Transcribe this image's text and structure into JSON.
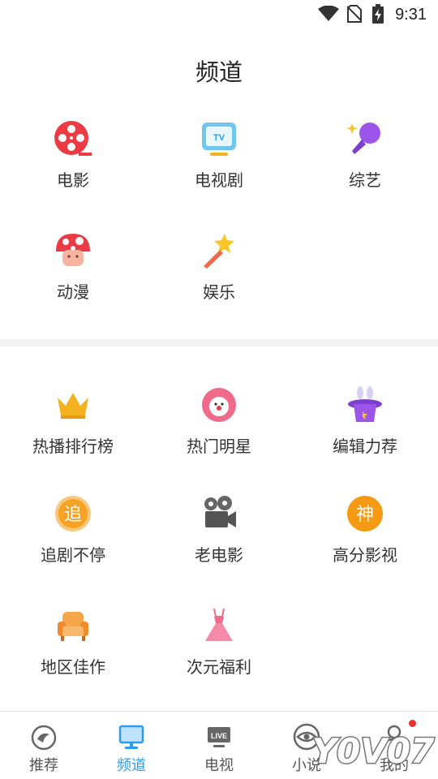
{
  "status": {
    "time": "9:31",
    "icons": [
      "wifi-icon",
      "no-sim-icon",
      "battery-charging-icon"
    ]
  },
  "page": {
    "title": "频道"
  },
  "channels": [
    {
      "label": "电影",
      "icon": "film-reel-icon"
    },
    {
      "label": "电视剧",
      "icon": "tv-icon"
    },
    {
      "label": "综艺",
      "icon": "microphone-icon"
    },
    {
      "label": "动漫",
      "icon": "mushroom-icon"
    },
    {
      "label": "娱乐",
      "icon": "magic-wand-icon"
    }
  ],
  "specials": [
    {
      "label": "热播排行榜",
      "icon": "crown-icon"
    },
    {
      "label": "热门明星",
      "icon": "clown-icon"
    },
    {
      "label": "编辑力荐",
      "icon": "magic-hat-icon"
    },
    {
      "label": "追剧不停",
      "icon": "zhui-badge-icon",
      "badge_text": "追"
    },
    {
      "label": "老电影",
      "icon": "movie-camera-icon"
    },
    {
      "label": "高分影视",
      "icon": "shen-badge-icon",
      "badge_text": "神"
    },
    {
      "label": "地区佳作",
      "icon": "armchair-icon"
    },
    {
      "label": "次元福利",
      "icon": "dress-icon"
    }
  ],
  "tabs": [
    {
      "label": "推荐",
      "icon": "recommend-icon",
      "active": false
    },
    {
      "label": "频道",
      "icon": "monitor-icon",
      "active": true
    },
    {
      "label": "电视",
      "icon": "live-tv-icon",
      "icon_text": "LIVE",
      "active": false
    },
    {
      "label": "小说",
      "icon": "eye-icon",
      "active": false
    },
    {
      "label": "我的",
      "icon": "user-icon",
      "active": false,
      "has_dot": true
    }
  ],
  "colors": {
    "active_tab": "#2d9cf0",
    "notification_dot": "#e8302f"
  },
  "watermark": {
    "text": "Y0V07"
  }
}
